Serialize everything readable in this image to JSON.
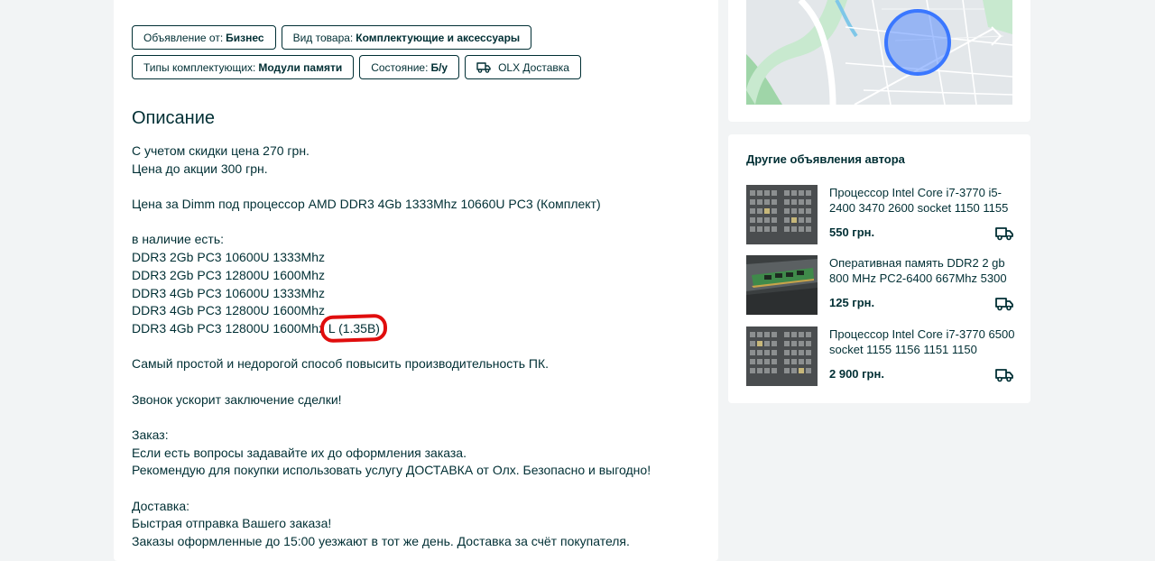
{
  "tags": {
    "row1": [
      {
        "label": "Объявление от:",
        "value": "Бизнес"
      },
      {
        "label": "Вид товара:",
        "value": "Комплектующие и аксессуары"
      }
    ],
    "row2": [
      {
        "label": "Типы комплектующих:",
        "value": "Модули памяти"
      },
      {
        "label": "Состояние:",
        "value": "Б/у"
      }
    ],
    "delivery": {
      "label": "OLX Доставка",
      "icon": "truck-icon"
    }
  },
  "description": {
    "title": "Описание",
    "lines": [
      "С учетом скидки цена 270 грн.",
      "Цена до акции 300 грн.",
      "",
      "Цена за Dimm под процессор AMD DDR3 4Gb 1333Mhz 10660U PC3 (Комплект)",
      "",
      "в наличие есть:",
      "DDR3 2Gb PC3 10600U 1333Mhz",
      "DDR3 2Gb PC3 12800U 1600Mhz",
      "DDR3 4Gb PC3 10600U 1333Mhz",
      "DDR3 4Gb PC3 12800U 1600Mhz"
    ],
    "circled_line": {
      "prefix": "DDR3 4Gb PC3 12800U 1600Mhz ",
      "circled": "L (1.35В)"
    },
    "lines_after": [
      "",
      "Самый простой и недорогой способ повысить производительность ПК.",
      "",
      "Звонок ускорит заключение сделки!",
      "",
      "Заказ:",
      "Если есть вопросы задавайте их до оформления заказа.",
      "Рекомендую для покупки использовать услугу ДОСТАВКА от Олх. Безопасно и выгодно!",
      "",
      "Доставка:",
      "Быстрая отправка Вашего заказа!",
      "Заказы оформленные до 15:00 уезжают в тот же день. Доставка за счёт покупателя."
    ],
    "highlight_color": "#e00d0d"
  },
  "author_ads": {
    "title": "Другие объявления автора",
    "items": [
      {
        "title": "Процессор Intel Core i7-3770 i5-2400 3470 2600 socket 1150 1155",
        "price": "550 грн.",
        "image": "cpu-tray-photo",
        "icon": "truck-icon"
      },
      {
        "title": "Оперативная память DDR2 2 gb 800 MHz PC2-6400 667Mhz 5300",
        "price": "125 грн.",
        "image": "ram-module-photo",
        "icon": "truck-icon"
      },
      {
        "title": "Процессор Intel Core i7-3770 6500 socket 1155 1156 1151 1150",
        "price": "2 900 грн.",
        "image": "cpu-tray-photo",
        "icon": "truck-icon"
      }
    ]
  },
  "colors": {
    "text": "#002f34",
    "page_bg": "#f2f4f5",
    "map_marker": "#3a77ff"
  }
}
